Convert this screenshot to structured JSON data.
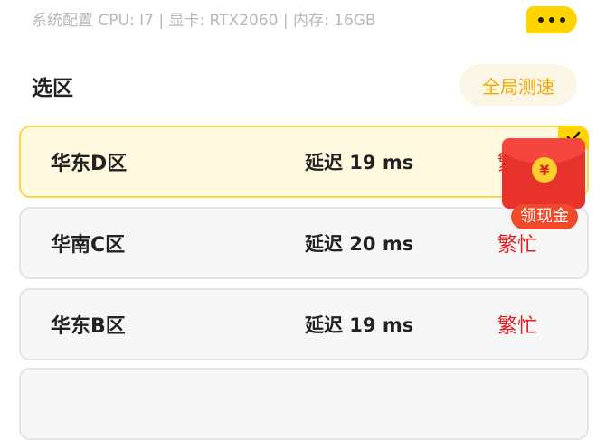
{
  "header": {
    "system_info": "系统配置 CPU: I7 | 显卡: RTX2060 | 内存: 16GB"
  },
  "section": {
    "title": "选区",
    "global_speed_button": "全局测速"
  },
  "regions": [
    {
      "name": "华东D区",
      "latency": "延迟 19 ms",
      "status": "繁忙",
      "selected": true
    },
    {
      "name": "华南C区",
      "latency": "延迟 20 ms",
      "status": "繁忙",
      "selected": false
    },
    {
      "name": "华东B区",
      "latency": "延迟 19 ms",
      "status": "繁忙",
      "selected": false
    }
  ],
  "promo": {
    "coin_symbol": "¥",
    "label": "领现金"
  },
  "colors": {
    "accent_yellow": "#ffd400",
    "status_red": "#e02020",
    "global_speed_text": "#f3a800"
  }
}
